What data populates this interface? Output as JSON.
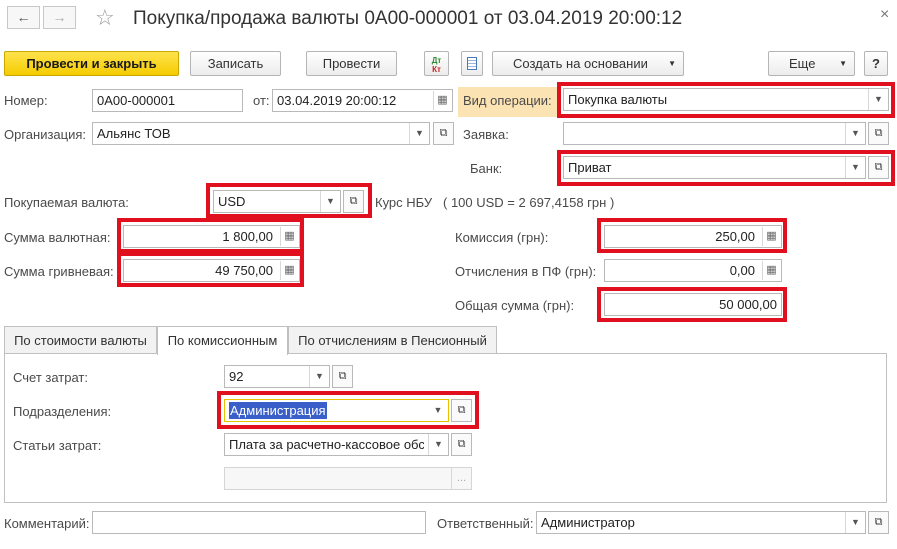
{
  "window": {
    "title": "Покупка/продажа валюты 0А00-000001 от 03.04.2019 20:00:12",
    "close_glyph": "×"
  },
  "toolbar": {
    "post_close_label": "Провести и закрыть",
    "save_label": "Записать",
    "post_label": "Провести",
    "dt_kt_top": "Дт",
    "dt_kt_bottom": "Кт",
    "create_based_label": "Создать на основании",
    "more_label": "Еще",
    "help_label": "?"
  },
  "header": {
    "number_label": "Номер:",
    "number_value": "0А00-000001",
    "date_label": "от:",
    "date_value": "03.04.2019 20:00:12",
    "operation_label": "Вид операции:",
    "operation_value": "Покупка валюты",
    "organization_label": "Организация:",
    "organization_value": "Альянс ТОВ",
    "request_label": "Заявка:",
    "request_value": "",
    "bank_label": "Банк:",
    "bank_value": "Приват"
  },
  "currency": {
    "label": "Покупаемая валюта:",
    "value": "USD",
    "rate_label": "Курс НБУ",
    "rate_value": "( 100 USD = 2 697,4158 грн )"
  },
  "amounts": {
    "currency_sum_label": "Сумма валютная:",
    "currency_sum_value": "1 800,00",
    "uah_sum_label": "Сумма гривневая:",
    "uah_sum_value": "49 750,00",
    "commission_label": "Комиссия (грн):",
    "commission_value": "250,00",
    "pension_label": "Отчисления в ПФ (грн):",
    "pension_value": "0,00",
    "total_label": "Общая сумма (грн):",
    "total_value": "50 000,00"
  },
  "tabs": [
    {
      "label": "По стоимости валюты"
    },
    {
      "label": "По комиссионным"
    },
    {
      "label": "По отчислениям в Пенсионный"
    }
  ],
  "commission_tab": {
    "account_label": "Счет затрат:",
    "account_value": "92",
    "division_label": "Подразделения:",
    "division_value": "Администрация",
    "cost_item_label": "Статьи затрат:",
    "cost_item_value": "Плата за расчетно-кассовое обсл",
    "extra_value": "",
    "extra_button": "..."
  },
  "footer": {
    "comment_label": "Комментарий:",
    "comment_value": "",
    "responsible_label": "Ответственный:",
    "responsible_value": "Администратор"
  },
  "colors": {
    "primary_button": "#f5cc00",
    "highlight_border": "#e0101e",
    "operation_label_bg": "#fbe3b4",
    "selection_bg": "#3b5fc9"
  }
}
